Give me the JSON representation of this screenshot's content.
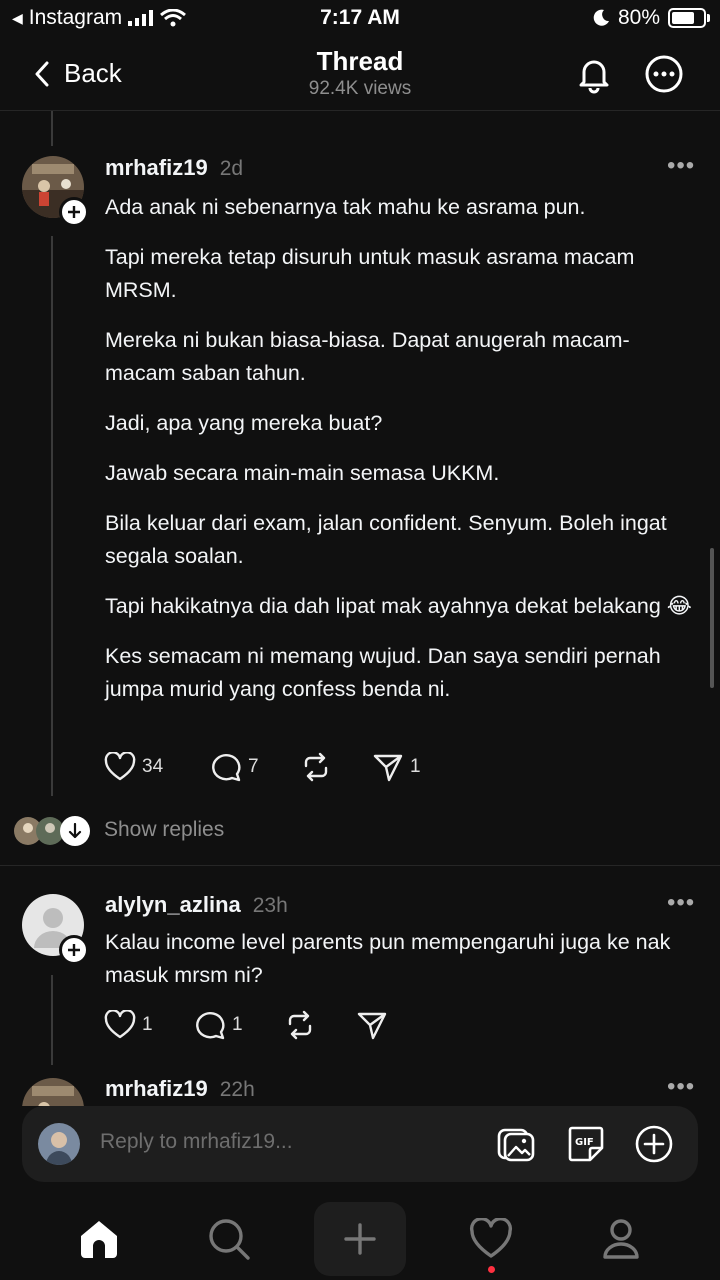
{
  "status_bar": {
    "back_app": "Instagram",
    "time": "7:17 AM",
    "battery": "80%",
    "battery_level": 0.8
  },
  "header": {
    "back_label": "Back",
    "title": "Thread",
    "views": "92.4K views"
  },
  "posts": [
    {
      "username": "mrhafiz19",
      "ago": "2d",
      "paragraphs": [
        "Ada anak ni sebenarnya tak mahu ke asrama pun.",
        "Tapi mereka tetap disuruh untuk masuk asrama macam MRSM.",
        "Mereka ni bukan biasa-biasa. Dapat anugerah macam-macam saban tahun.",
        "Jadi, apa yang mereka buat?",
        "Jawab secara main-main semasa UKKM.",
        "Bila keluar dari exam, jalan confident. Senyum. Boleh ingat segala soalan.",
        "Tapi hakikatnya dia dah lipat mak ayahnya dekat belakang 😂",
        "Kes semacam ni memang wujud. Dan saya sendiri pernah jumpa murid yang confess benda ni."
      ],
      "likes": "34",
      "comments": "7",
      "shares": "1"
    },
    {
      "username": "alylyn_azlina",
      "ago": "23h",
      "paragraphs": [
        "Kalau income level parents pun mempengaruhi juga ke nak masuk mrsm ni?"
      ],
      "likes": "1",
      "comments": "1"
    },
    {
      "username": "mrhafiz19",
      "ago": "22h"
    }
  ],
  "show_replies": "Show replies",
  "reply": {
    "placeholder": "Reply to mrhafiz19..."
  }
}
